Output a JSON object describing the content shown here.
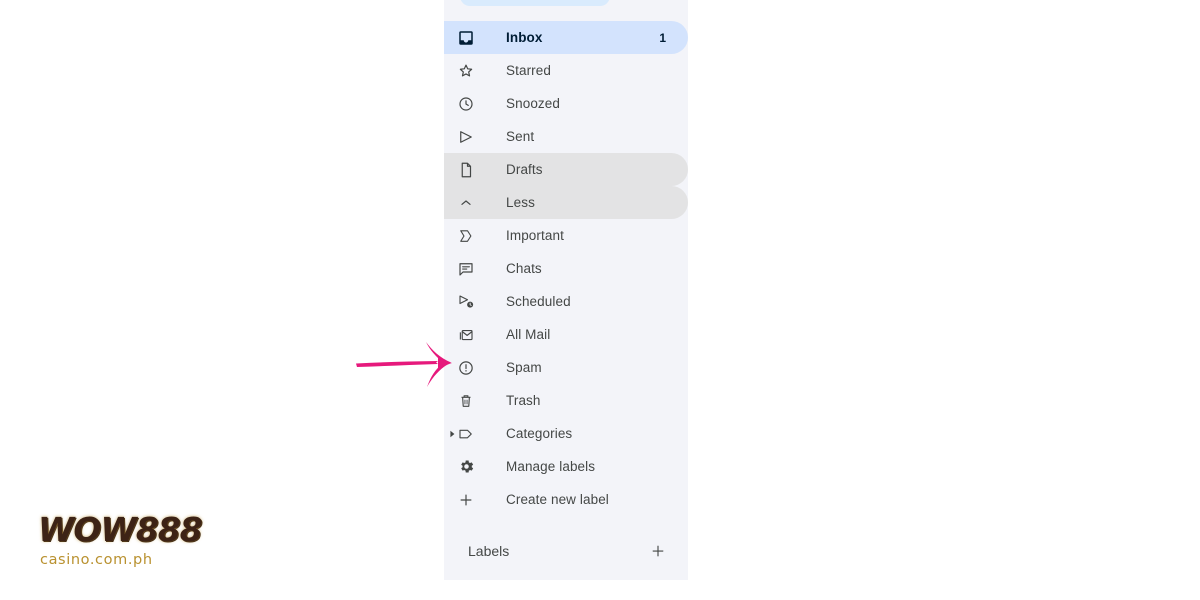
{
  "sidebar": {
    "background_color": "#f3f4f9",
    "selected_color": "#d3e3fd",
    "hover_color": "#e3e3e4",
    "nav_items": [
      {
        "label": "Inbox",
        "icon": "inbox-icon",
        "count": "1",
        "state": "selected"
      },
      {
        "label": "Starred",
        "icon": "star-icon",
        "count": "",
        "state": "normal"
      },
      {
        "label": "Snoozed",
        "icon": "clock-icon",
        "count": "",
        "state": "normal"
      },
      {
        "label": "Sent",
        "icon": "send-icon",
        "count": "",
        "state": "normal"
      },
      {
        "label": "Drafts",
        "icon": "document-icon",
        "count": "",
        "state": "hovered"
      },
      {
        "label": "Less",
        "icon": "chevron-up-icon",
        "count": "",
        "state": "hovered"
      },
      {
        "label": "Important",
        "icon": "important-tag-icon",
        "count": "",
        "state": "normal"
      },
      {
        "label": "Chats",
        "icon": "chat-bubble-icon",
        "count": "",
        "state": "normal"
      },
      {
        "label": "Scheduled",
        "icon": "scheduled-send-icon",
        "count": "",
        "state": "normal"
      },
      {
        "label": "All Mail",
        "icon": "all-mail-icon",
        "count": "",
        "state": "normal"
      },
      {
        "label": "Spam",
        "icon": "spam-icon",
        "count": "",
        "state": "normal"
      },
      {
        "label": "Trash",
        "icon": "trash-icon",
        "count": "",
        "state": "normal"
      },
      {
        "label": "Categories",
        "icon": "label-tag-icon",
        "count": "",
        "state": "normal",
        "expandable": true
      },
      {
        "label": "Manage labels",
        "icon": "gear-icon",
        "count": "",
        "state": "normal"
      },
      {
        "label": "Create new label",
        "icon": "plus-icon",
        "count": "",
        "state": "normal"
      }
    ],
    "labels_section": {
      "title": "Labels",
      "add_icon": "plus-icon"
    }
  },
  "annotation": {
    "arrow": {
      "icon": "right-arrow-annotation",
      "color": "#e6197c",
      "points_to": "Spam"
    }
  },
  "logo": {
    "main_text": "WOW888",
    "sub_text": "casino.com.ph",
    "main_color": "#3d2316",
    "sub_color": "#b9912f"
  }
}
